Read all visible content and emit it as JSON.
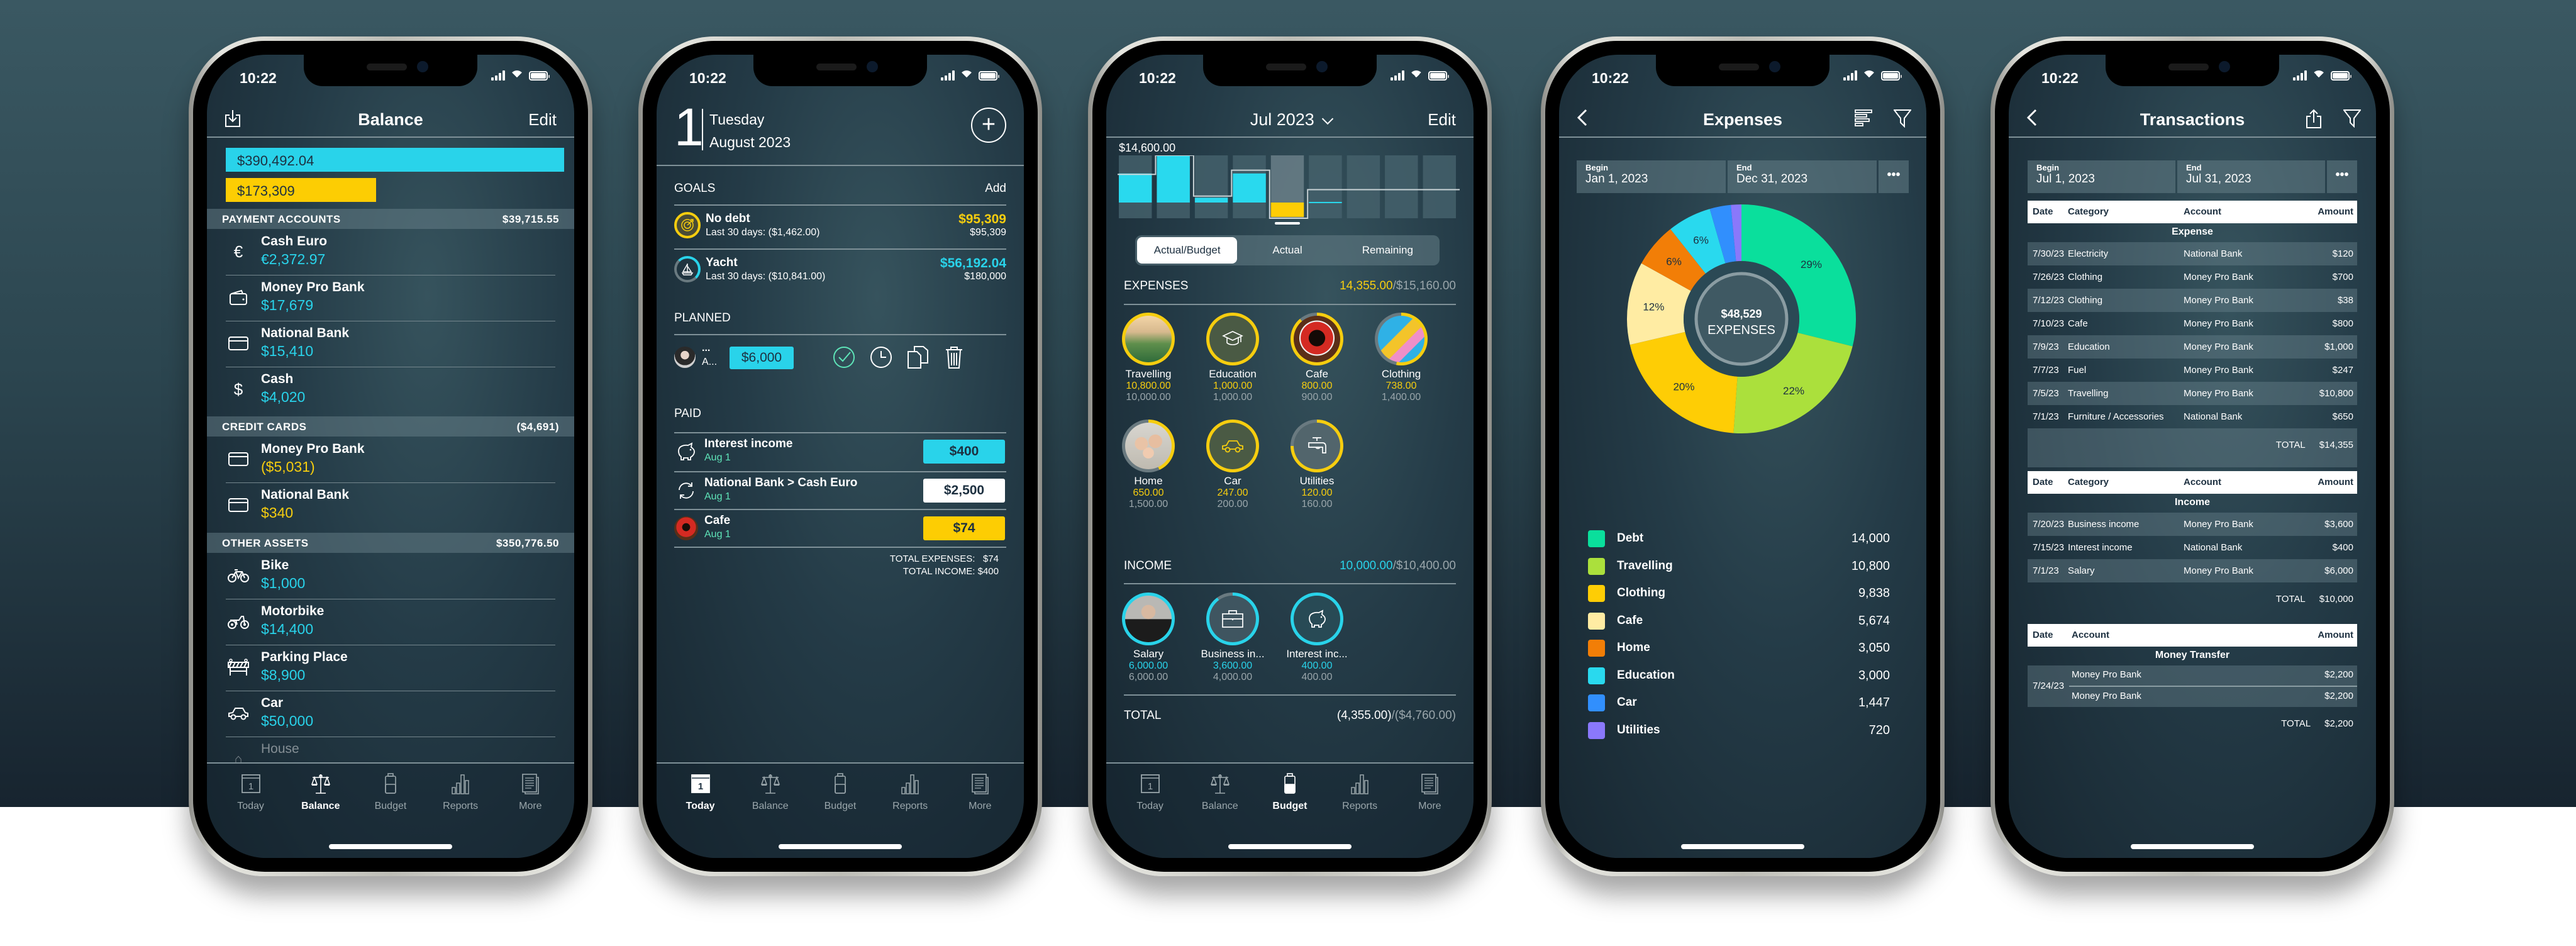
{
  "status_bar": {
    "time": "10:22"
  },
  "tabbar": {
    "tabs": [
      {
        "label": "Today",
        "icon": "calendar-icon",
        "day": "1"
      },
      {
        "label": "Balance",
        "icon": "scales-icon"
      },
      {
        "label": "Budget",
        "icon": "battery-jar-icon"
      },
      {
        "label": "Reports",
        "icon": "bar-chart-icon"
      },
      {
        "label": "More",
        "icon": "document-icon"
      }
    ]
  },
  "balance_screen": {
    "title": "Balance",
    "edit_label": "Edit",
    "assets_total": "$390,492.04",
    "liabilities_total": "$173,309",
    "assets_fill": 1.0,
    "liabilities_fill": 0.444,
    "sections": [
      {
        "name": "PAYMENT ACCOUNTS",
        "total": "$39,715.55",
        "accounts": [
          {
            "name": "Cash Euro",
            "amount": "€2,372.97",
            "icon": "euro-icon",
            "negative": false
          },
          {
            "name": "Money Pro Bank",
            "amount": "$17,679",
            "icon": "wallet-icon",
            "negative": false
          },
          {
            "name": "National Bank",
            "amount": "$15,410",
            "icon": "credit-card-icon",
            "negative": false
          },
          {
            "name": "Cash",
            "amount": "$4,020",
            "icon": "dollar-icon",
            "negative": false
          }
        ]
      },
      {
        "name": "CREDIT CARDS",
        "total": "($4,691)",
        "accounts": [
          {
            "name": "Money Pro Bank",
            "amount": "($5,031)",
            "icon": "credit-card-icon",
            "negative": true
          },
          {
            "name": "National Bank",
            "amount": "$340",
            "icon": "credit-card-icon",
            "negative": true
          }
        ]
      },
      {
        "name": "OTHER ASSETS",
        "total": "$350,776.50",
        "accounts": [
          {
            "name": "Bike",
            "amount": "$1,000",
            "icon": "bicycle-icon",
            "negative": false
          },
          {
            "name": "Motorbike",
            "amount": "$14,400",
            "icon": "motorbike-icon",
            "negative": false
          },
          {
            "name": "Parking Place",
            "amount": "$8,900",
            "icon": "barrier-icon",
            "negative": false
          },
          {
            "name": "Car",
            "amount": "$50,000",
            "icon": "car-icon",
            "negative": false
          },
          {
            "name": "House",
            "amount": "",
            "icon": "house-icon",
            "negative": false
          }
        ]
      }
    ]
  },
  "today_screen": {
    "day": "1",
    "weekday": "Tuesday",
    "month_year": "August 2023",
    "goals_label": "GOALS",
    "add_label": "Add",
    "goals": [
      {
        "name": "No debt",
        "sub": "Last 30 days: ($1,462.00)",
        "value": "$95,309",
        "target": "$95,309",
        "color": "#f6cd0f",
        "progress": 1.0
      },
      {
        "name": "Yacht",
        "sub": "Last 30 days: ($10,841.00)",
        "value": "$56,192.04",
        "target": "$180,000",
        "color": "#29d3ea",
        "progress": 0.31
      }
    ],
    "planned_label": "PLANNED",
    "planned": {
      "name": "...",
      "sub": "A...",
      "amount": "$6,000"
    },
    "paid_label": "PAID",
    "paid": [
      {
        "name": "Interest income",
        "date": "Aug 1",
        "amount": "$400",
        "kind": "income"
      },
      {
        "name": "National Bank > Cash Euro",
        "date": "Aug 1",
        "amount": "$2,500",
        "kind": "transfer"
      },
      {
        "name": "Cafe",
        "date": "Aug 1",
        "amount": "$74",
        "kind": "expense"
      }
    ],
    "total_expenses_label": "TOTAL EXPENSES:",
    "total_expenses": "$74",
    "total_income_label": "TOTAL INCOME:",
    "total_income": "$400"
  },
  "budget_screen": {
    "period": "Jul 2023",
    "edit_label": "Edit",
    "chart_max_label": "$14,600.00",
    "chart": {
      "max": 14600,
      "zero_fraction": 0.75,
      "actual": [
        9000,
        14600,
        1500,
        9000,
        -4355,
        200,
        0,
        0,
        0
      ],
      "budget": [
        8700,
        14600,
        2000,
        10000,
        -4760,
        4000,
        4000,
        4000,
        4000
      ],
      "selected_index": 4
    },
    "segments": [
      "Actual/Budget",
      "Actual",
      "Remaining"
    ],
    "selected_segment": 0,
    "expenses_label": "EXPENSES",
    "expenses_actual": "14,355.00",
    "expenses_budget": "/$15,160.00",
    "expense_categories": [
      {
        "name": "Travelling",
        "actual": "10,800.00",
        "budget": "10,000.00",
        "progress": 1.0,
        "icon": "landscape-photo",
        "bg": "#4c8a6a"
      },
      {
        "name": "Education",
        "actual": "1,000.00",
        "budget": "1,000.00",
        "progress": 1.0,
        "icon": "graduation-cap-icon",
        "bg": "#4a5a44"
      },
      {
        "name": "Cafe",
        "actual": "800.00",
        "budget": "900.00",
        "progress": 0.89,
        "icon": "coffee-cup-photo",
        "bg": "#7a2a22"
      },
      {
        "name": "Clothing",
        "actual": "738.00",
        "budget": "1,400.00",
        "progress": 0.53,
        "icon": "shopping-bags-photo",
        "bg": "#2aa6d6"
      },
      {
        "name": "Home",
        "actual": "650.00",
        "budget": "1,500.00",
        "progress": 0.43,
        "icon": "family-photo",
        "bg": "#c7c2b8"
      },
      {
        "name": "Car",
        "actual": "247.00",
        "budget": "200.00",
        "progress": 1.0,
        "icon": "car-icon",
        "bg": "#4a5a44"
      },
      {
        "name": "Utilities",
        "actual": "120.00",
        "budget": "160.00",
        "progress": 0.75,
        "icon": "faucet-icon",
        "bg": "#52656c"
      }
    ],
    "income_label": "INCOME",
    "income_actual": "10,000.00",
    "income_budget": "/$10,400.00",
    "income_categories": [
      {
        "name": "Salary",
        "actual": "6,000.00",
        "budget": "6,000.00",
        "progress": 1.0,
        "icon": "businessman-photo",
        "bg": "#b9b8b4"
      },
      {
        "name": "Business in...",
        "actual": "3,600.00",
        "budget": "4,000.00",
        "progress": 0.9,
        "icon": "briefcase-icon",
        "bg": "#3f5560"
      },
      {
        "name": "Interest inc...",
        "actual": "400.00",
        "budget": "400.00",
        "progress": 1.0,
        "icon": "piggy-bank-icon",
        "bg": "#284a55"
      }
    ],
    "total_label": "TOTAL",
    "total_actual": "(4,355.00)",
    "total_budget": "/($4,760.00)"
  },
  "expenses_screen": {
    "title": "Expenses",
    "begin_label": "Begin",
    "begin_value": "Jan 1, 2023",
    "end_label": "End",
    "end_value": "Dec 31, 2023",
    "more_label": "•••",
    "center_amount": "$48,529",
    "center_label": "EXPENSES"
  },
  "chart_data": {
    "type": "pie",
    "title": "Expenses",
    "total": 48529,
    "categories": [
      "Debt",
      "Travelling",
      "Clothing",
      "Cafe",
      "Home",
      "Education",
      "Car",
      "Utilities"
    ],
    "values": [
      14000,
      10800,
      9838,
      5674,
      3050,
      3000,
      1447,
      720
    ],
    "value_labels": [
      "14,000",
      "10,800",
      "9,838",
      "5,674",
      "3,050",
      "3,000",
      "1,447",
      "720"
    ],
    "percent_labels": [
      "29%",
      "22%",
      "20%",
      "12%",
      "6%",
      "6%",
      "",
      ""
    ],
    "colors": [
      "#0adf9c",
      "#abe03c",
      "#fecd05",
      "#ffeca3",
      "#f27e07",
      "#29d9ee",
      "#318ffd",
      "#8a78fb"
    ],
    "legend": "bottom"
  },
  "transactions_screen": {
    "title": "Transactions",
    "begin_label": "Begin",
    "begin_value": "Jul 1, 2023",
    "end_label": "End",
    "end_value": "Jul 31, 2023",
    "more_label": "•••",
    "columns": [
      "Date",
      "Category",
      "Account",
      "Amount"
    ],
    "transfer_columns": [
      "Date",
      "Account",
      "Amount"
    ],
    "total_label": "TOTAL",
    "expense": {
      "group": "Expense",
      "rows": [
        [
          "7/30/23",
          "Electricity",
          "National Bank",
          "$120"
        ],
        [
          "7/26/23",
          "Clothing",
          "Money Pro Bank",
          "$700"
        ],
        [
          "7/12/23",
          "Clothing",
          "Money Pro Bank",
          "$38"
        ],
        [
          "7/10/23",
          "Cafe",
          "Money Pro Bank",
          "$800"
        ],
        [
          "7/9/23",
          "Education",
          "Money Pro Bank",
          "$1,000"
        ],
        [
          "7/7/23",
          "Fuel",
          "Money Pro Bank",
          "$247"
        ],
        [
          "7/5/23",
          "Travelling",
          "Money Pro Bank",
          "$10,800"
        ],
        [
          "7/1/23",
          "Furniture / Accessories",
          "National Bank",
          "$650"
        ]
      ],
      "total": "$14,355"
    },
    "income": {
      "group": "Income",
      "rows": [
        [
          "7/20/23",
          "Business income",
          "Money Pro Bank",
          "$3,600"
        ],
        [
          "7/15/23",
          "Interest income",
          "National Bank",
          "$400"
        ],
        [
          "7/1/23",
          "Salary",
          "Money Pro Bank",
          "$6,000"
        ]
      ],
      "total": "$10,000"
    },
    "transfer": {
      "group": "Money Transfer",
      "date": "7/24/23",
      "from": "Money Pro Bank",
      "from_amount": "$2,200",
      "to": "Money Pro Bank",
      "to_amount": "$2,200",
      "total": "$2,200"
    }
  },
  "colors": {
    "cyan": "#29d3ea",
    "yellow": "#f6cd0f",
    "green_date": "#5ee4b8",
    "muted": "#9aa6ab"
  }
}
